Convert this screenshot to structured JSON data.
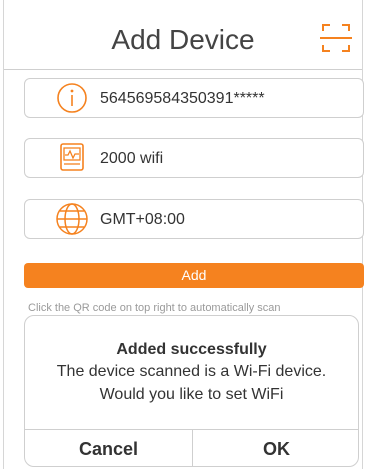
{
  "header": {
    "title": "Add Device",
    "scan_icon": "qr-scan-icon"
  },
  "fields": [
    {
      "icon": "info-icon",
      "value": "564569584350391*****"
    },
    {
      "icon": "wifi-device-icon",
      "value": "2000 wifi"
    },
    {
      "icon": "globe-icon",
      "value": "GMT+08:00"
    }
  ],
  "add_button": {
    "label": "Add"
  },
  "hint": "Click the QR code on top right to automatically scan",
  "dialog": {
    "title": "Added successfully",
    "message_line1": "The device scanned is a Wi-Fi device.",
    "message_line2": "Would you like to set WiFi",
    "cancel_label": "Cancel",
    "ok_label": "OK"
  },
  "colors": {
    "accent": "#f5821f",
    "border": "#cfcfcf",
    "text": "#333333",
    "hint": "#9a9a9a"
  }
}
